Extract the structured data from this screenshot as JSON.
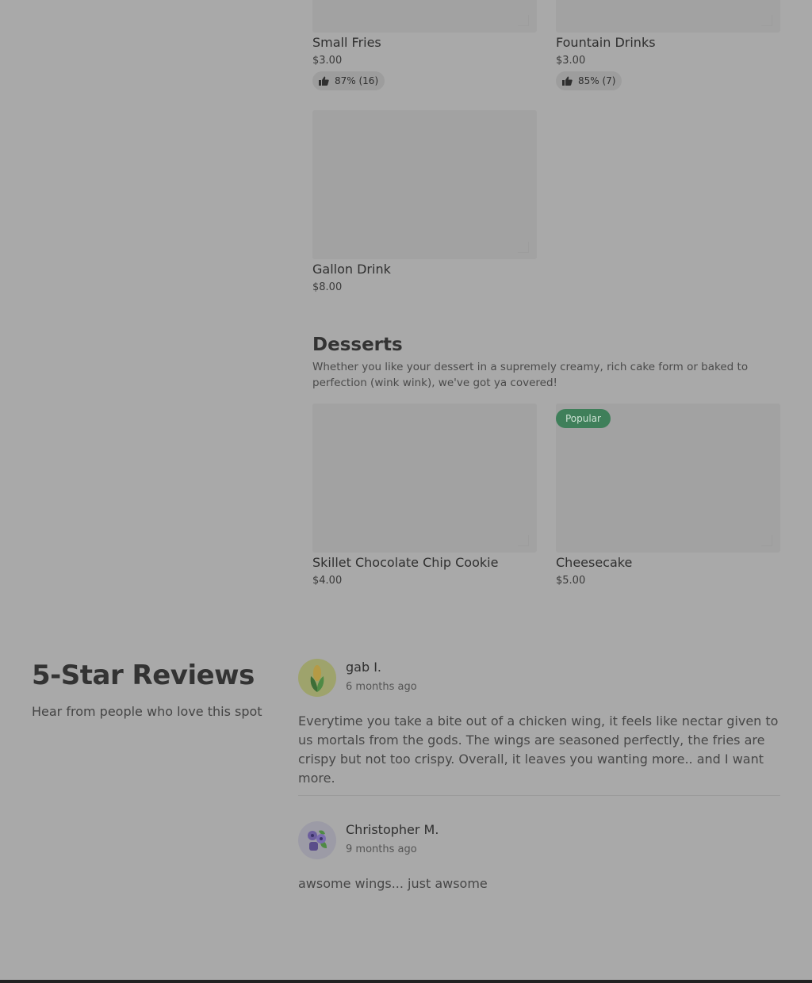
{
  "menu": {
    "drinks_items": [
      {
        "name": "Small Fries",
        "price": "$3.00",
        "rating": "87% (16)"
      },
      {
        "name": "Fountain Drinks",
        "price": "$3.00",
        "rating": "85% (7)"
      },
      {
        "name": "Gallon Drink",
        "price": "$8.00"
      }
    ],
    "desserts": {
      "title": "Desserts",
      "description": "Whether you like your dessert in a supremely creamy, rich cake form or baked to perfection (wink wink), we've got ya covered!",
      "items": [
        {
          "name": "Skillet Chocolate Chip Cookie",
          "price": "$4.00"
        },
        {
          "name": "Cheesecake",
          "price": "$5.00",
          "badge": "Popular"
        }
      ]
    }
  },
  "reviews": {
    "title": "5-Star Reviews",
    "subtitle": "Hear from people who love this spot",
    "items": [
      {
        "name": "gab I.",
        "time": "6 months ago",
        "avatar_icon": "corn-icon",
        "text": "Everytime you take a bite out of a chicken wing, it feels like nectar given to us mortals from the gods. The wings are seasoned perfectly, the fries are crispy but not too crispy. Overall, it leaves you wanting more.. and I want more."
      },
      {
        "name": "Christopher M.",
        "time": "9 months ago",
        "avatar_icon": "blueberry-icon",
        "text": "awsome wings... just awsome"
      }
    ]
  },
  "colors": {
    "overlay_background": "#a9a9a9",
    "popular_badge": "#3f7f5a"
  }
}
